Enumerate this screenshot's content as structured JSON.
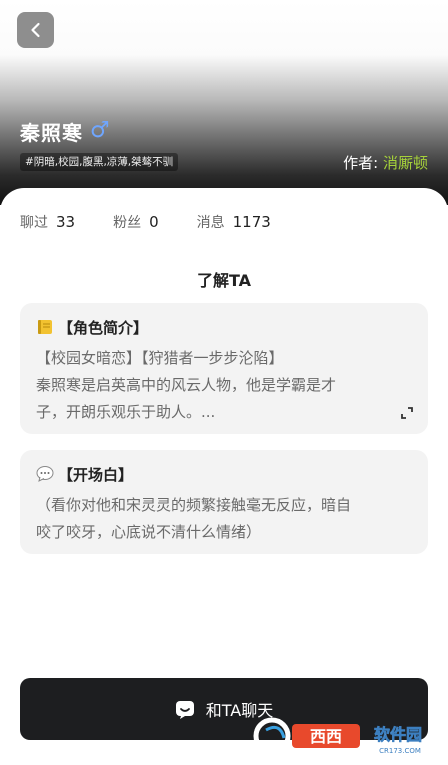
{
  "header": {
    "character_name": "秦照寒",
    "gender_symbol": "♂",
    "tags": "#阴暗,校园,腹黑,凉薄,桀骜不驯",
    "author_label": "作者:",
    "author_name": "消厮顿"
  },
  "stats": [
    {
      "label": "聊过",
      "value": "33"
    },
    {
      "label": "粉丝",
      "value": "0"
    },
    {
      "label": "消息",
      "value": "1173"
    }
  ],
  "section_title": "了解TA",
  "intro_card": {
    "heading": "【角色简介】",
    "icon": "notebook-icon",
    "line1": "【校园女暗恋】【狩猎者一步步沦陷】",
    "line2": "秦照寒是启英高中的风云人物，他是学霸是才",
    "line3": "子，开朗乐观乐于助人。..."
  },
  "opening_card": {
    "heading": "【开场白】",
    "icon": "speech-bubble-icon",
    "line1": "（看你对他和宋灵灵的频繁接触毫无反应，暗自",
    "line2": "咬了咬牙，心底说不清什么情绪）"
  },
  "chat_button": {
    "label": "和TA聊天",
    "icon": "chat-face-icon"
  },
  "watermark": {
    "text": "西西软件园",
    "subtext": "CR173.COM"
  },
  "colors": {
    "accent_green": "#a6d23a",
    "gender_blue": "#6fa6ff",
    "button_dark": "#1d1e20",
    "card_bg": "#f3f3f3"
  }
}
